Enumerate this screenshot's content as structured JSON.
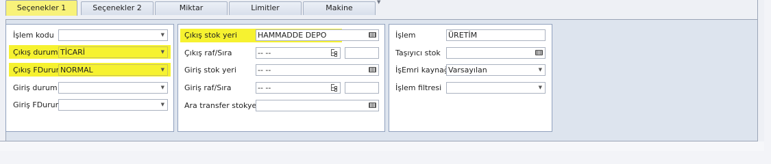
{
  "tabs": [
    "Seçenekler 1",
    "Seçenekler 2",
    "Miktar",
    "Limitler",
    "Makine"
  ],
  "active_tab": 0,
  "colors": {
    "highlight": "#f6f230",
    "active_tab": "#f8f27a",
    "panel_bg": "#dde4ee"
  },
  "group1": {
    "islem_kodu": {
      "label": "İşlem kodu",
      "value": ""
    },
    "cikis_durum": {
      "label": "Çıkış durum",
      "value": "TİCARİ"
    },
    "cikis_fdurum": {
      "label": "Çıkış FDurum",
      "value": "NORMAL"
    },
    "giris_durum": {
      "label": "Giriş durum",
      "value": ""
    },
    "giris_fdurum": {
      "label": "Giriş FDurum",
      "value": ""
    }
  },
  "group2": {
    "cikis_stok_yeri": {
      "label": "Çıkış stok yeri",
      "value": "HAMMADDE DEPO"
    },
    "cikis_raf_sira": {
      "label": "Çıkış raf/Sıra",
      "value": "-- --",
      "extra": ""
    },
    "giris_stok_yeri": {
      "label": "Giriş stok yeri",
      "value": "-- --"
    },
    "giris_raf_sira": {
      "label": "Giriş raf/Sıra",
      "value": "-- --",
      "extra": ""
    },
    "ara_transfer": {
      "label": "Ara transfer stokyeri",
      "value": ""
    }
  },
  "group3": {
    "islem": {
      "label": "İşlem",
      "value": "ÜRETİM"
    },
    "tasiyici_stok": {
      "label": "Taşıyıcı stok",
      "value": ""
    },
    "isemri_kaynagi": {
      "label": "İşEmri kaynağı",
      "value": "Varsayılan"
    },
    "islem_filtresi": {
      "label": "İşlem filtresi",
      "value": ""
    }
  }
}
